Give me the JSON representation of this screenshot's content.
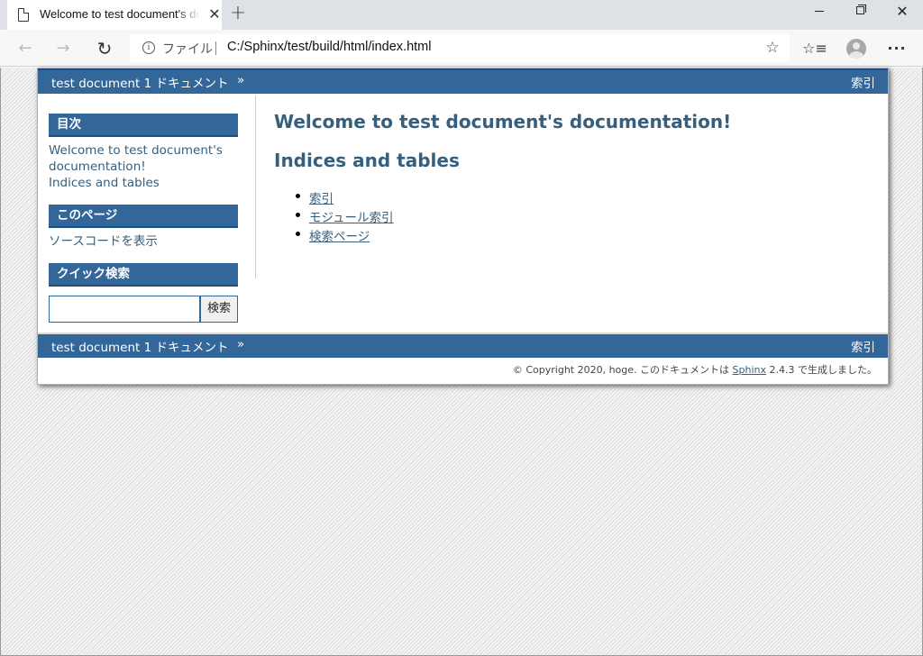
{
  "browser": {
    "tab_title": "Welcome to test document's documentation!",
    "tab_close": "✕",
    "new_tab": "+",
    "file_label": "ファイル",
    "url": "C:/Sphinx/test/build/html/index.html",
    "icons": {
      "back": "back-arrow-icon",
      "forward": "forward-arrow-icon",
      "reload": "reload-icon",
      "info": "info-icon",
      "favorite": "star-icon",
      "favorites": "favorites-list-icon",
      "profile": "profile-icon",
      "more": "more-icon"
    },
    "more_label": "···",
    "window_close": "✕"
  },
  "relbar": {
    "home_label": "test document 1 ドキュメント",
    "arrow": "»",
    "index_label": "索引"
  },
  "sidebar": {
    "toc_heading": "目次",
    "toc_items": [
      "Welcome to test document's documentation!",
      "Indices and tables"
    ],
    "this_page_heading": "このページ",
    "show_source": "ソースコードを表示",
    "quick_search_heading": "クイック検索",
    "search_button": "検索"
  },
  "content": {
    "title": "Welcome to test document's documentation!",
    "subtitle": "Indices and tables",
    "links": [
      "索引",
      "モジュール索引",
      "検索ページ"
    ]
  },
  "footer": {
    "copyright_prefix": "© Copyright 2020, hoge. このドキュメントは ",
    "sphinx_link": "Sphinx",
    "copyright_suffix": " 2.4.3 で生成しました。"
  },
  "colors": {
    "bar": "#336699",
    "link": "#355f7c"
  }
}
